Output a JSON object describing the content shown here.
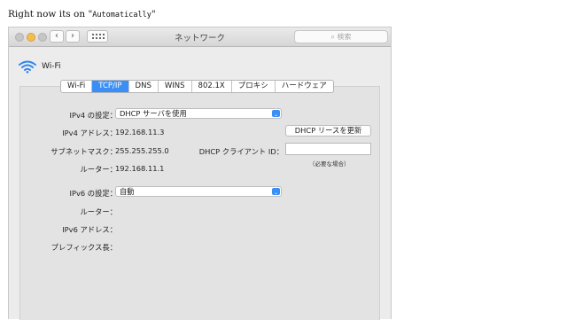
{
  "caption": {
    "prefix": "Right now its on \"",
    "code": "Automatically",
    "suffix": "\""
  },
  "window": {
    "title": "ネットワーク",
    "search_placeholder": "⌕ 検索"
  },
  "service": {
    "name": "Wi-Fi"
  },
  "tabs": [
    "Wi-Fi",
    "TCP/IP",
    "DNS",
    "WINS",
    "802.1X",
    "プロキシ",
    "ハードウェア"
  ],
  "active_tab": "TCP/IP",
  "ipv4": {
    "config_label": "IPv4 の設定：",
    "config_value": "DHCP サーバを使用",
    "address_label": "IPv4 アドレス：",
    "address_value": "192.168.11.3",
    "renew_button": "DHCP リースを更新",
    "subnet_label": "サブネットマスク：",
    "subnet_value": "255.255.255.0",
    "client_id_label": "DHCP クライアント ID：",
    "client_id_value": "",
    "client_id_hint": "（必要な場合）",
    "router_label": "ルーター：",
    "router_value": "192.168.11.1"
  },
  "ipv6": {
    "config_label": "IPv6 の設定：",
    "config_value": "自動",
    "router_label": "ルーター：",
    "address_label": "IPv6 アドレス：",
    "prefix_label": "プレフィックス長："
  }
}
